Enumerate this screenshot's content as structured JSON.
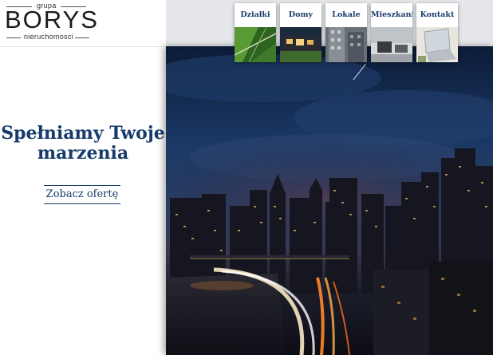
{
  "logo": {
    "top_text": "grupa",
    "main_text": "BORYS",
    "bottom_text": "nieruchomosci"
  },
  "hero": {
    "title_line1": "Spełniamy Twoje",
    "title_line2": "marzenia",
    "cta_label": "Zobacz ofertę"
  },
  "nav": {
    "items": [
      {
        "label": "Działki",
        "icon": "field-thumbnail"
      },
      {
        "label": "Domy",
        "icon": "house-thumbnail"
      },
      {
        "label": "Lokale",
        "icon": "building-thumbnail"
      },
      {
        "label": "Mieszkania",
        "icon": "apartment-thumbnail"
      },
      {
        "label": "Kontakt",
        "icon": "laptop-thumbnail"
      }
    ]
  },
  "colors": {
    "brand_navy": "#173b6a",
    "topbar": "#e4e6ea",
    "sky_dark": "#0c1b37"
  }
}
